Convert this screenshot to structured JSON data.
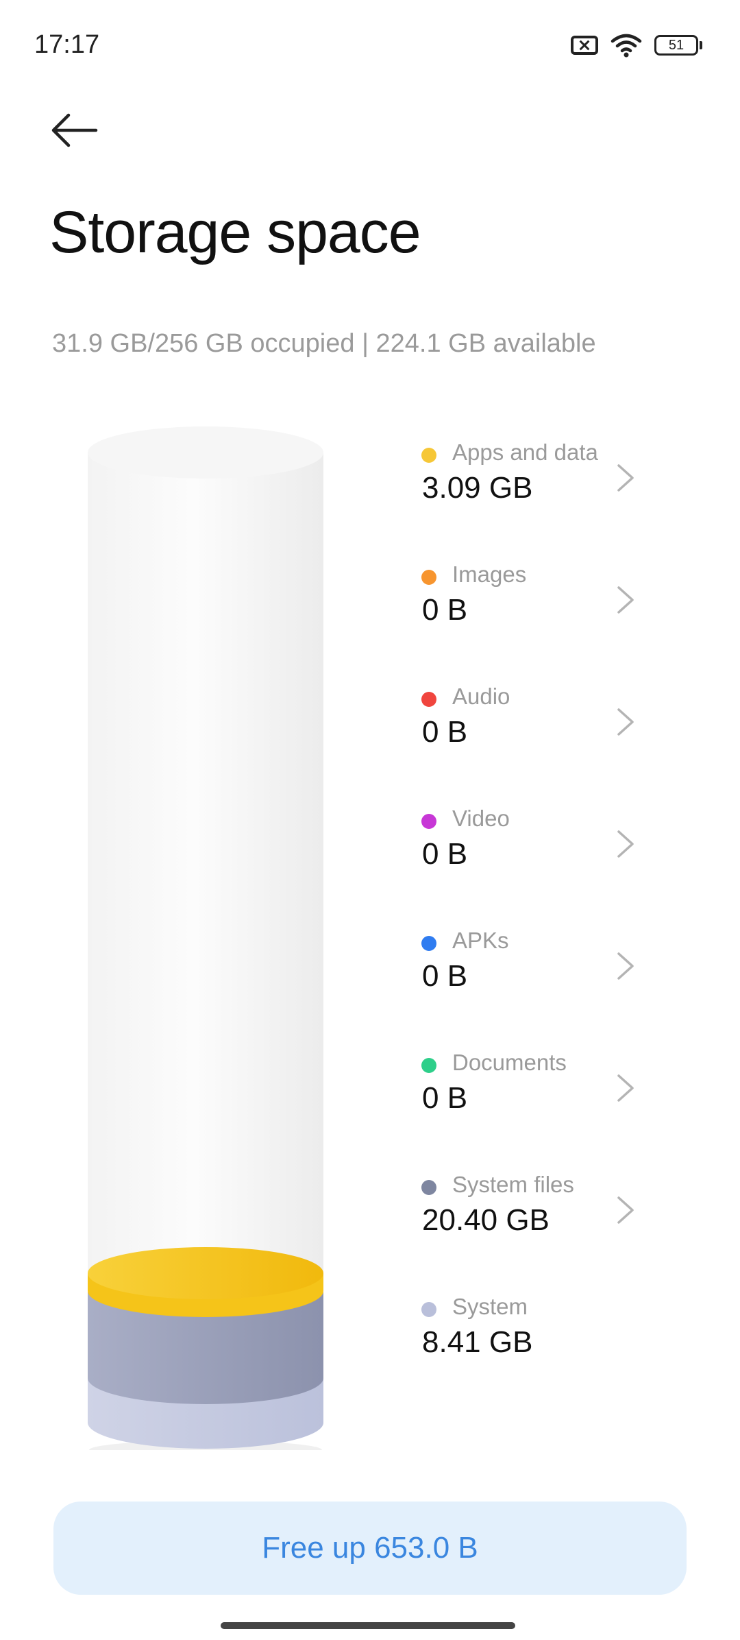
{
  "status_bar": {
    "time": "17:17",
    "battery": "51",
    "icons": [
      "sim-disabled-icon",
      "wifi-icon",
      "battery-icon"
    ]
  },
  "header": {
    "back_icon": "arrow-left-icon",
    "title": "Storage space"
  },
  "summary": "31.9 GB/256 GB occupied | 224.1 GB available",
  "categories": [
    {
      "label": "Apps and data",
      "value": "3.09 GB",
      "color": "#F6C737",
      "has_chevron": true
    },
    {
      "label": "Images",
      "value": "0 B",
      "color": "#F7952F",
      "has_chevron": true
    },
    {
      "label": "Audio",
      "value": "0 B",
      "color": "#F0453E",
      "has_chevron": true
    },
    {
      "label": "Video",
      "value": "0 B",
      "color": "#C737D6",
      "has_chevron": true
    },
    {
      "label": "APKs",
      "value": "0 B",
      "color": "#2F7CF0",
      "has_chevron": true
    },
    {
      "label": "Documents",
      "value": "0 B",
      "color": "#2ECF8A",
      "has_chevron": true
    },
    {
      "label": "System files",
      "value": "20.40 GB",
      "color": "#7E86A0",
      "has_chevron": true
    },
    {
      "label": "System",
      "value": "8.41 GB",
      "color": "#B9BFDA",
      "has_chevron": false
    }
  ],
  "actions": {
    "free_up_label": "Free up 653.0 B",
    "accent_color": "#3A86DF"
  }
}
